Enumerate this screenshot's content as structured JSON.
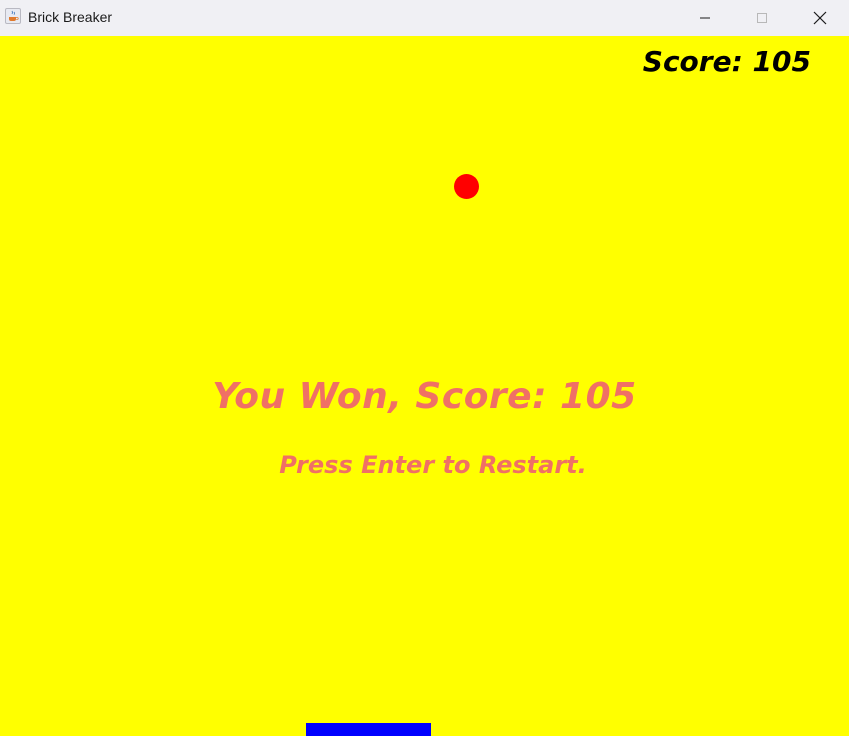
{
  "window": {
    "title": "Brick Breaker",
    "icon": "java-cup-icon",
    "controls": [
      "minimize-icon",
      "maximize-icon",
      "close-icon"
    ]
  },
  "game": {
    "score_label": "Score: 105",
    "win_message": "You Won, Score: 105",
    "restart_message": "Press Enter to Restart.",
    "colors": {
      "background": "#ffff00",
      "ball": "#ff0000",
      "paddle": "#0000ff",
      "message": "#f07065",
      "score": "#000000"
    }
  }
}
